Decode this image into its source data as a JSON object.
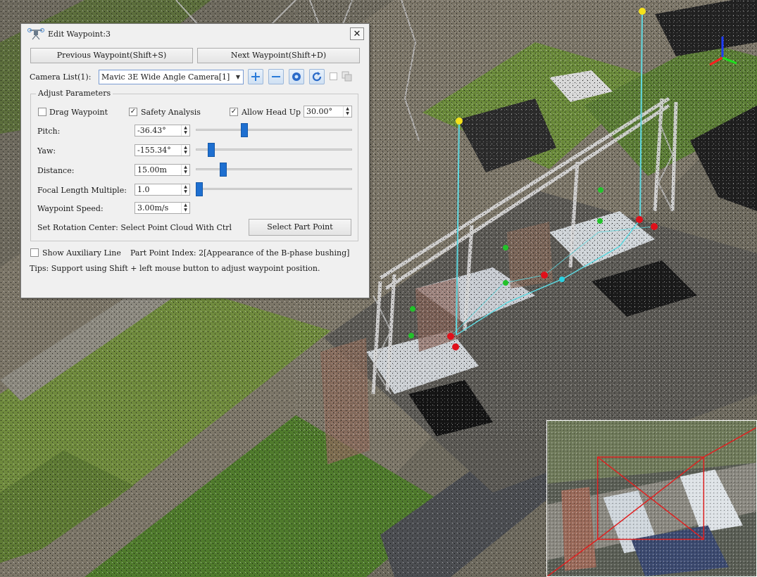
{
  "dialog": {
    "title": "Edit Waypoint:3",
    "close_glyph": "✕",
    "prev_button": "Previous Waypoint(Shift+S)",
    "next_button": "Next Waypoint(Shift+D)",
    "camera_list_label": "Camera List(1):",
    "camera_selected": "Mavic 3E Wide Angle Camera[1]",
    "tool_icons": [
      "plus-icon",
      "minus-icon",
      "lens-icon",
      "refresh-icon"
    ],
    "group_title": "Adjust Parameters",
    "drag_waypoint": {
      "label": "Drag Waypoint",
      "checked": false
    },
    "safety_analysis": {
      "label": "Safety Analysis",
      "checked": true
    },
    "allow_head_up": {
      "label": "Allow Head Up",
      "checked": true,
      "value": "30.00°"
    },
    "pitch": {
      "label": "Pitch:",
      "value": "-36.43°",
      "slider_fraction": 0.3
    },
    "yaw": {
      "label": "Yaw:",
      "value": "-155.34°",
      "slider_fraction": 0.08
    },
    "distance": {
      "label": "Distance:",
      "value": "15.00m",
      "slider_fraction": 0.16
    },
    "focal": {
      "label": "Focal Length Multiple:",
      "value": "1.0",
      "slider_fraction": 0.0
    },
    "speed": {
      "label": "Waypoint Speed:",
      "value": "3.00m/s"
    },
    "rotation_center": "Set Rotation Center: Select Point Cloud With Ctrl",
    "select_part_button": "Select Part Point",
    "show_aux": {
      "label": "Show Auxiliary Line",
      "checked": false
    },
    "part_index": "Part Point Index: 2[Appearance of the B-phase bushing]",
    "tips": "Tips: Support using Shift + left mouse button to adjust waypoint position."
  },
  "colors": {
    "waypoint_yellow": "#f5e21a",
    "point_red": "#e0101a",
    "point_green": "#22c22a",
    "route_cyan": "#5fd8e0",
    "slider_blue": "#1e6fd0"
  }
}
